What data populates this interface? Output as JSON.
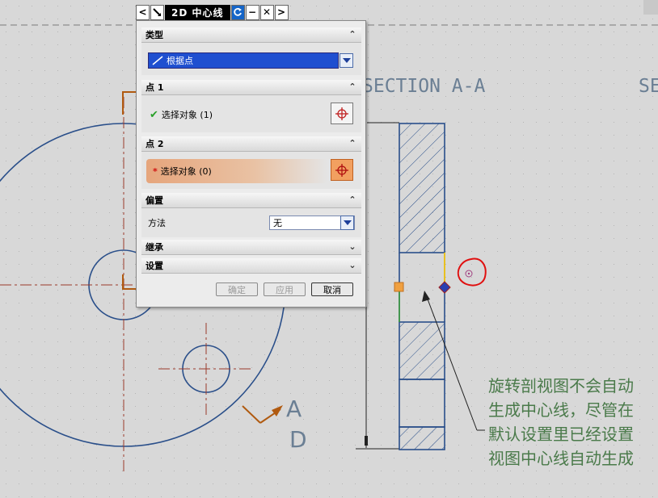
{
  "toolbar": {
    "prev_label": "<",
    "next_label": ">",
    "title": "2D 中心线",
    "minimize_label": "−",
    "close_label": "✕"
  },
  "dialog": {
    "type_section": {
      "title": "类型",
      "selected": "根据点"
    },
    "point1_section": {
      "title": "点 1",
      "label": "选择对象 (1)"
    },
    "point2_section": {
      "title": "点 2",
      "label": "选择对象 (0)"
    },
    "offset_section": {
      "title": "偏置",
      "method_label": "方法",
      "method_value": "无"
    },
    "inherit_section": {
      "title": "继承"
    },
    "settings_section": {
      "title": "设置"
    },
    "buttons": {
      "ok": "确定",
      "apply": "应用",
      "cancel": "取消"
    }
  },
  "drawing": {
    "section_label_1": "SECTION A-A",
    "section_label_2": "SE",
    "letter_a": "A",
    "letter_d": "D",
    "annotation_lines": [
      "旋转剖视图不会自动",
      "生成中心线，尽管在",
      "默认设置里已经设置",
      "视图中心线自动生成"
    ]
  },
  "colors": {
    "background": "#d8d8d8",
    "geometry": "#2a4f8a",
    "centerline": "#9a3a2a",
    "highlight_circle": "#e01010",
    "annotation": "#4a7a4a"
  }
}
